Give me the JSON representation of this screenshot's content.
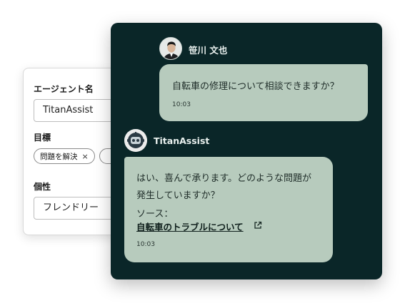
{
  "settings": {
    "agent_name_label": "エージェント名",
    "agent_name_value": "TitanAssist",
    "goal_label": "目標",
    "goal_chips": [
      "問題を解決",
      ""
    ],
    "personality_label": "個性",
    "personality_value": "フレンドリー"
  },
  "chat": {
    "user": {
      "name": "笹川 文也",
      "message": "自転車の修理について相談できますか？",
      "time": "10:03"
    },
    "bot": {
      "name": "TitanAssist",
      "message_line1": "はい、喜んで承ります。どのような問題が",
      "message_line2": "発生していますか？",
      "source_label": "ソース：",
      "source_link": "自転車のトラブルについて",
      "time": "10:03"
    }
  },
  "colors": {
    "panel_bg": "#0a2628",
    "bubble_bg": "#b7cbbd"
  },
  "icons": {
    "chip_remove": "close-icon",
    "source_link": "external-link-icon"
  }
}
